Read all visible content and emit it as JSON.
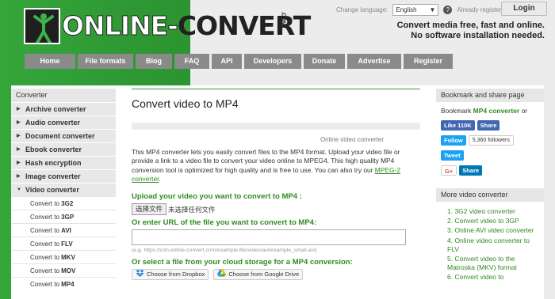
{
  "header": {
    "logo_text_a": "ONLINE-",
    "logo_text_b": "CONVERT",
    "logo_com": ".COM",
    "change_language_label": "Change language:",
    "language_value": "English",
    "already_registered": "Already registered?",
    "login_label": "Login",
    "tagline_line1": "Convert media free, fast and online.",
    "tagline_line2": "No software installation needed."
  },
  "nav": [
    {
      "label": "Home",
      "w": 64
    },
    {
      "label": "File formats",
      "w": 70
    },
    {
      "label": "Blog",
      "w": 46
    },
    {
      "label": "FAQ",
      "w": 44
    },
    {
      "label": "API",
      "w": 38
    },
    {
      "label": "Developers",
      "w": 72
    },
    {
      "label": "Donate",
      "w": 52
    },
    {
      "label": "Advertise",
      "w": 68
    },
    {
      "label": "Register",
      "w": 62
    }
  ],
  "sidebar": {
    "heading": "Converter",
    "categories": [
      {
        "label": "Archive converter",
        "expanded": false
      },
      {
        "label": "Audio converter",
        "expanded": false
      },
      {
        "label": "Document converter",
        "expanded": false
      },
      {
        "label": "Ebook converter",
        "expanded": false
      },
      {
        "label": "Hash encryption",
        "expanded": false
      },
      {
        "label": "Image converter",
        "expanded": false
      },
      {
        "label": "Video converter",
        "expanded": true
      }
    ],
    "sub_items": [
      {
        "prefix": "Convert to ",
        "format": "3G2"
      },
      {
        "prefix": "Convert to ",
        "format": "3GP"
      },
      {
        "prefix": "Convert to ",
        "format": "AVI"
      },
      {
        "prefix": "Convert to ",
        "format": "FLV"
      },
      {
        "prefix": "Convert to ",
        "format": "MKV"
      },
      {
        "prefix": "Convert to ",
        "format": "MOV"
      },
      {
        "prefix": "Convert to ",
        "format": "MP4"
      }
    ]
  },
  "main": {
    "title": "Convert video to MP4",
    "section_label": "Online video converter",
    "description": "This MP4 converter lets you easily convert files to the MP4 format. Upload your video file or provide a link to a video file to convert your video online to MPEG4. This high quality MP4 conversion tool is optimized for high quality and is free to use. You can also try our ",
    "description_link": "MPEG-2 converter",
    "description_end": ".",
    "upload_heading": "Upload your video you want to convert to MP4 :",
    "file_button": "选择文件",
    "file_status": "未选择任何文件",
    "url_heading": "Or enter URL of the file you want to convert to MP4:",
    "url_placeholder": "",
    "url_hint": "(e.g. https://cdn.online-convert.com/example-file/video/avi/example_small.avi)",
    "cloud_heading": "Or select a file from your cloud storage for a MP4 conversion:",
    "dropbox_label": "Choose from Dropbox",
    "gdrive_label": "Choose from Google Drive"
  },
  "aside": {
    "bookmark_heading": "Bookmark and share page",
    "bookmark_text": "Bookmark ",
    "bookmark_link": "MP4 converter",
    "bookmark_tail": " or",
    "fb_like": "Like 110K",
    "fb_share": "Share",
    "tw_follow": "Follow",
    "tw_followers": "5,360 followers",
    "tw_tweet": "Tweet",
    "gp_label": "G+",
    "li_share": "Share",
    "more_heading": "More video converter",
    "more_items": [
      "1. 3G2 video converter",
      "2. Convert video to 3GP",
      "3. Online AVI video converter",
      "4. Online video converter to FLV",
      "5. Convert video to the Matroska (MKV) format",
      "6. Convert video to"
    ]
  }
}
